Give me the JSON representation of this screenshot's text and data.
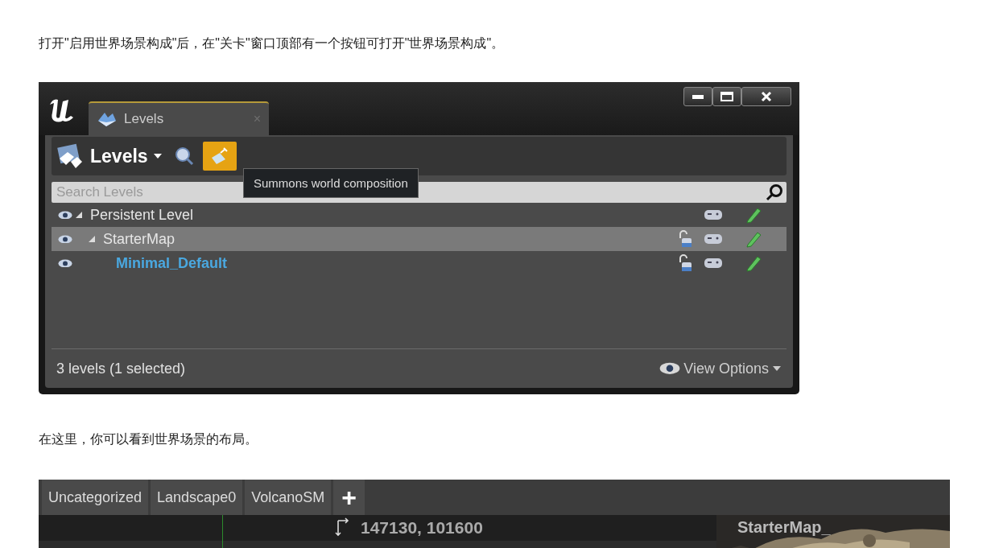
{
  "paragraphs": [
    "打开\"启用世界场景构成\"后，在\"关卡\"窗口顶部有一个按钮可打开\"世界场景构成\"。",
    "在这里，你可以看到世界场景的布局。"
  ],
  "levels_window": {
    "tab": {
      "label": "Levels",
      "close": "×",
      "selected": true
    },
    "toolbar": {
      "title": "Levels",
      "world_button": {
        "active": true
      }
    },
    "tooltip": "Summons world composition",
    "search": {
      "placeholder": "Search Levels"
    },
    "tree": [
      {
        "name": "Persistent Level",
        "expanded": true,
        "selected": false,
        "current": false,
        "children": [
          {
            "name": "StarterMap",
            "locked": false,
            "expanded": true,
            "selected": true,
            "current": false,
            "children": [
              {
                "name": "Minimal_Default",
                "locked": false,
                "selected": false,
                "current": true
              }
            ]
          }
        ]
      }
    ],
    "status": "3 levels (1 selected)",
    "view_options": "View Options"
  },
  "composition": {
    "tabs": [
      {
        "label": "Uncategorized"
      },
      {
        "label": "Landscape0"
      },
      {
        "label": "VolcanoSM"
      }
    ],
    "add_button": "+",
    "coordinates": "147130, 101600",
    "preview": {
      "kind": "picture",
      "label": "StarterMap_"
    }
  }
}
